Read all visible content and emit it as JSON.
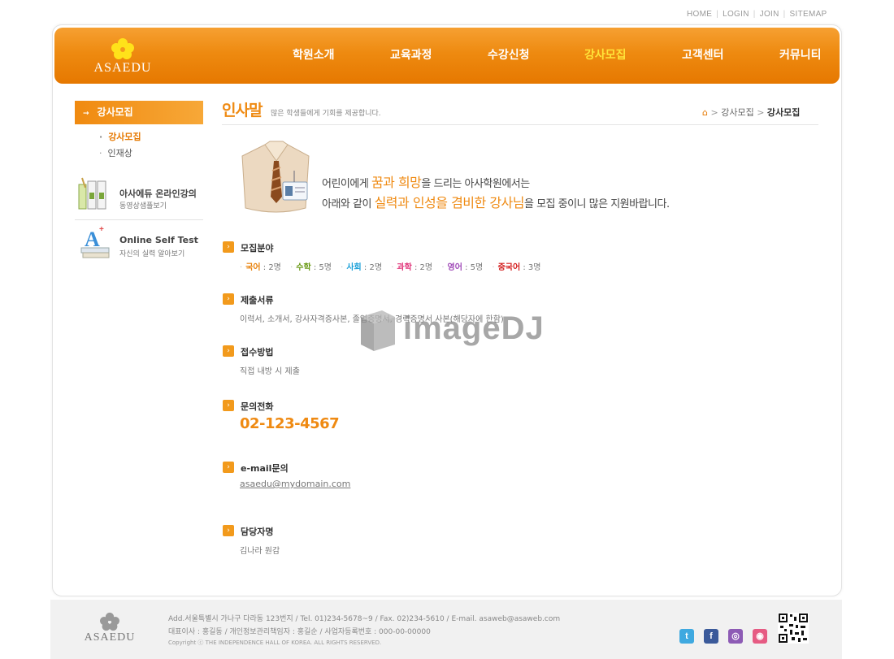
{
  "util_nav": [
    "HOME",
    "LOGIN",
    "JOIN",
    "SITEMAP"
  ],
  "logo": "ASAEDU",
  "gnb": [
    "학원소개",
    "교육과정",
    "수강신청",
    "강사모집",
    "고객센터",
    "커뮤니티"
  ],
  "gnb_active": "강사모집",
  "sidebar": {
    "title": "강사모집",
    "items": [
      {
        "label": "강사모집",
        "active": true
      },
      {
        "label": "인재상",
        "active": false
      }
    ],
    "banners": [
      {
        "title": "아사에듀 온라인강의",
        "sub": "동영상샘플보기",
        "icon": "books-icon"
      },
      {
        "title": "Online Self Test",
        "sub": "자신의 실력 알아보기",
        "icon": "a-plus-icon"
      }
    ]
  },
  "page": {
    "title": "인사말",
    "desc": "많은 학생들에게 기회를 제공합니다.",
    "breadcrumb": [
      "강사모집",
      "강사모집"
    ]
  },
  "intro": {
    "line1_pre": "어린이에게 ",
    "line1_hl": "꿈과 희망",
    "line1_post": "을 드리는 아사학원에서는",
    "line2_pre": "아래와 같이 ",
    "line2_hl": "실력과 인성을 겸비한 강사님",
    "line2_post": "을 모집 중이니 많은 지원바랍니다."
  },
  "sections": {
    "field": {
      "title": "모집분야",
      "subjects": [
        {
          "name": "국어",
          "count": " : 2명",
          "color": "#e8820c"
        },
        {
          "name": "수학",
          "count": " : 5명",
          "color": "#6a9a16"
        },
        {
          "name": "사회",
          "count": " : 2명",
          "color": "#1aa0d8"
        },
        {
          "name": "과학",
          "count": " : 2명",
          "color": "#e0367a"
        },
        {
          "name": "영어",
          "count": " : 5명",
          "color": "#a04ab8"
        },
        {
          "name": "중국어",
          "count": " : 3명",
          "color": "#d41f1f"
        }
      ]
    },
    "docs": {
      "title": "제출서류",
      "body": "이력서, 소개서, 강사자격증사본, 졸업증명서, 경력증명서 사본(해당자에 한함)"
    },
    "method": {
      "title": "접수방법",
      "body": "직접 내방 시 제출"
    },
    "phone": {
      "title": "문의전화",
      "body": "02-123-4567"
    },
    "email": {
      "title": "e-mail문의",
      "body": "asaedu@mydomain.com"
    },
    "manager": {
      "title": "담당자명",
      "body": "김나라 원감"
    }
  },
  "watermark": "imageDJ",
  "footer": {
    "logo": "ASAEDU",
    "line1": "Add.서울특별시 가나구 다라동 123번지  / Tel. 01)234-5678~9  / Fax. 02)234-5610  / E-mail. asaweb@asaweb.com",
    "line2": "대표이사 : 홍길동  / 개인정보관리책임자 : 홍길순  / 사업자등록번호 : 000-00-00000",
    "copyright": "Copyright ⓒ THE INDEPENDENCE HALL OF KOREA. ALL RIGHTS RESERVED.",
    "sns": [
      {
        "name": "twitter-icon",
        "glyph": "t",
        "color": "#3fa9e0"
      },
      {
        "name": "facebook-icon",
        "glyph": "f",
        "color": "#3b5a9a"
      },
      {
        "name": "blog-icon",
        "glyph": "◎",
        "color": "#8d5bb5"
      },
      {
        "name": "me2day-icon",
        "glyph": "◉",
        "color": "#e65b83"
      }
    ]
  },
  "colors": {
    "accent": "#ef8a12",
    "header": "#ee8a10",
    "active_gnb": "#ffe43a"
  }
}
